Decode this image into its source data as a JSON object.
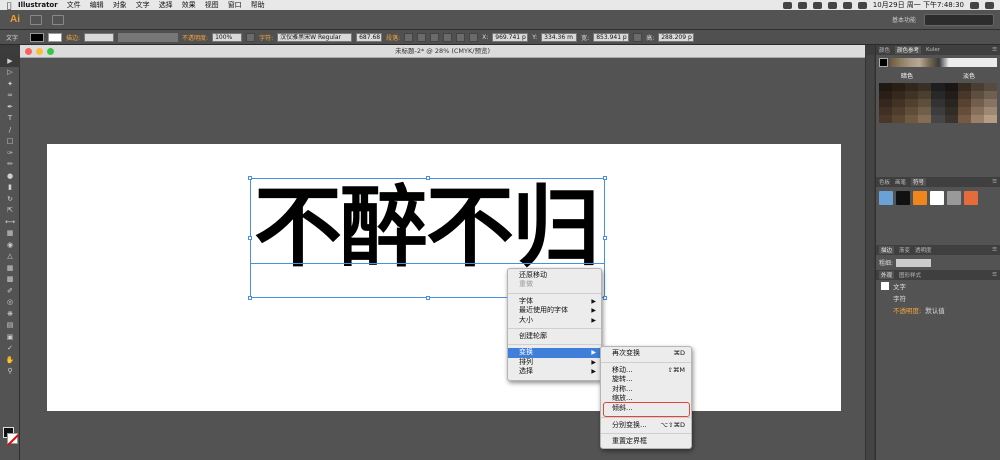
{
  "menubar": {
    "app": "Illustrator",
    "items": [
      "文件",
      "编辑",
      "对象",
      "文字",
      "选择",
      "效果",
      "视图",
      "窗口",
      "帮助"
    ],
    "clock": "10月29日 周一 下午7:48:30"
  },
  "appbar": {
    "logo": "Ai",
    "workspace": "基本功能"
  },
  "control": {
    "mode": "文字",
    "stroke_label": "描边:",
    "opacity_label": "不透明度:",
    "opacity_value": "100%",
    "font_label": "字符:",
    "font_value": "汉仪雅黑宋W Regular",
    "size_value": "687.68",
    "para_label": "段落:",
    "x_label": "X:",
    "x_value": "969.741 p",
    "y_label": "Y:",
    "y_value": "334.36 m",
    "w_label": "宽:",
    "w_value": "853.941 p",
    "h_label": "高:",
    "h_value": "288.209 p"
  },
  "document": {
    "title": "未标题-2* @ 28% (CMYK/预览)"
  },
  "canvas": {
    "text": "不醉不归"
  },
  "context_menu": {
    "undo": "还原移动",
    "redo": "重做",
    "font": "字体",
    "recent_font": "最近使用的字体",
    "size": "大小",
    "outline": "创建轮廓",
    "transform": "变换",
    "arrange": "排列",
    "select": "选择"
  },
  "submenu": {
    "again": "再次变换",
    "again_sc": "⌘D",
    "move": "移动...",
    "move_sc": "⇧⌘M",
    "rotate": "旋转...",
    "reflect": "对称...",
    "scale": "缩放...",
    "shear": "倾斜...",
    "each": "分别变换...",
    "each_sc": "⌥⇧⌘D",
    "reset": "重置定界框"
  },
  "panels": {
    "tabs1": [
      "颜色",
      "颜色参考",
      "Kuler"
    ],
    "left_label": "暗色",
    "right_label": "淡色",
    "tabs2": [
      "色板",
      "画笔",
      "符号"
    ],
    "tabs3": [
      "描边",
      "渐变",
      "透明度"
    ],
    "weight_label": "粗细:",
    "tabs4": [
      "外观",
      "图形样式"
    ],
    "app_title": "文字",
    "app_char": "字符",
    "app_opacity": "不透明度:",
    "app_opacity_val": "默认值"
  },
  "colors": {
    "accent_orange": "#f3a63a",
    "highlight_blue": "#3f7fd9",
    "callout_red": "#e0453a"
  }
}
